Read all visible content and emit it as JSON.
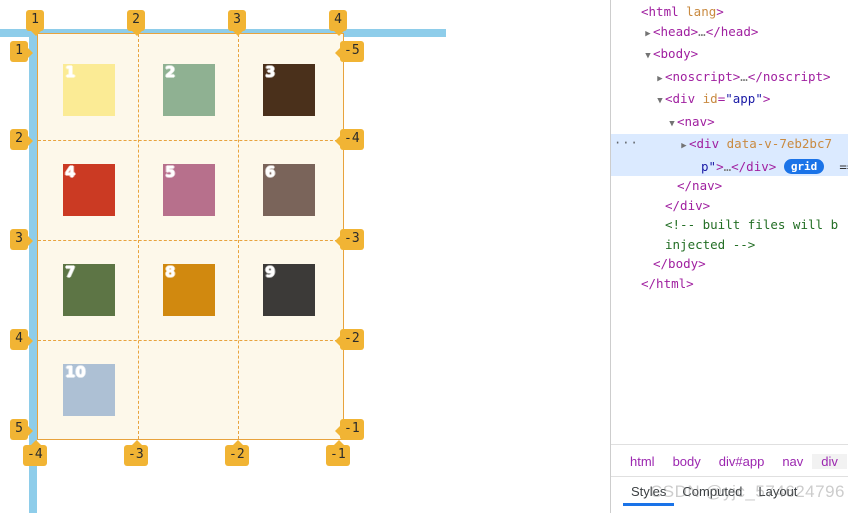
{
  "inspector": {
    "container_label": "grid-overlay",
    "grid": {
      "columns": 3,
      "rows": 4,
      "col_badges_top": [
        "1",
        "2",
        "3",
        "4"
      ],
      "col_badges_bottom": [
        "-4",
        "-3",
        "-2",
        "-1"
      ],
      "row_badges_left": [
        "1",
        "2",
        "3",
        "4",
        "5"
      ],
      "row_badges_right": [
        "-5",
        "-4",
        "-3",
        "-2",
        "-1"
      ]
    },
    "items": [
      {
        "label": "1",
        "color": "#fbeb95"
      },
      {
        "label": "2",
        "color": "#8fb192"
      },
      {
        "label": "3",
        "color": "#4a301b"
      },
      {
        "label": "4",
        "color": "#cb3a23"
      },
      {
        "label": "5",
        "color": "#b7708c"
      },
      {
        "label": "6",
        "color": "#7a645a"
      },
      {
        "label": "7",
        "color": "#5d7545"
      },
      {
        "label": "8",
        "color": "#d1890f"
      },
      {
        "label": "9",
        "color": "#3c3a38"
      },
      {
        "label": "10",
        "color": "#adc0d4"
      }
    ],
    "colors": {
      "overlay_line": "#e8a33d",
      "overlay_fill": "#fdf8ea",
      "badge_bg": "#f1b434",
      "element_highlight": "#8ecdea"
    }
  },
  "devtools": {
    "dom": [
      {
        "indent": 1,
        "twisty": "",
        "parts": [
          {
            "t": "tag",
            "s": "<html "
          },
          {
            "t": "attr",
            "s": "lang"
          },
          {
            "t": "tag",
            "s": ">"
          }
        ]
      },
      {
        "indent": 2,
        "twisty": "▶",
        "parts": [
          {
            "t": "tag",
            "s": "<head>"
          },
          {
            "t": "ellip",
            "s": "…"
          },
          {
            "t": "tag",
            "s": "</head>"
          }
        ]
      },
      {
        "indent": 2,
        "twisty": "▼",
        "parts": [
          {
            "t": "tag",
            "s": "<body>"
          }
        ]
      },
      {
        "indent": 3,
        "twisty": "▶",
        "parts": [
          {
            "t": "tag",
            "s": "<noscript>"
          },
          {
            "t": "ellip",
            "s": "…"
          },
          {
            "t": "tag",
            "s": "</noscript>"
          }
        ]
      },
      {
        "indent": 3,
        "twisty": "▼",
        "parts": [
          {
            "t": "tag",
            "s": "<div "
          },
          {
            "t": "attr",
            "s": "id"
          },
          {
            "t": "tag",
            "s": "="
          },
          {
            "t": "val",
            "s": "\"app\""
          },
          {
            "t": "tag",
            "s": ">"
          }
        ]
      },
      {
        "indent": 4,
        "twisty": "▼",
        "parts": [
          {
            "t": "tag",
            "s": "<nav>"
          }
        ]
      },
      {
        "indent": 5,
        "twisty": "▶",
        "selected": true,
        "dots": "···",
        "parts": [
          {
            "t": "tag",
            "s": "<div "
          },
          {
            "t": "attr",
            "s": "data-v-7eb2bc7"
          }
        ]
      },
      {
        "indent": 6,
        "twisty": "",
        "selected": true,
        "parts": [
          {
            "t": "val",
            "s": "p\""
          },
          {
            "t": "tag",
            "s": ">"
          },
          {
            "t": "ellip",
            "s": "…"
          },
          {
            "t": "tag",
            "s": "</div> "
          },
          {
            "t": "chip",
            "s": "grid"
          },
          {
            "t": "txt",
            "s": "  =="
          }
        ]
      },
      {
        "indent": 4,
        "twisty": "",
        "parts": [
          {
            "t": "tag",
            "s": "</nav>"
          }
        ]
      },
      {
        "indent": 3,
        "twisty": "",
        "parts": [
          {
            "t": "tag",
            "s": "</div>"
          }
        ]
      },
      {
        "indent": 3,
        "twisty": "",
        "parts": [
          {
            "t": "cmt",
            "s": "<!-- built files will b"
          }
        ]
      },
      {
        "indent": 3,
        "twisty": "",
        "parts": [
          {
            "t": "cmt",
            "s": "injected -->"
          }
        ]
      },
      {
        "indent": 2,
        "twisty": "",
        "parts": [
          {
            "t": "tag",
            "s": "</body>"
          }
        ]
      },
      {
        "indent": 1,
        "twisty": "",
        "parts": [
          {
            "t": "tag",
            "s": "</html>"
          }
        ]
      }
    ],
    "breadcrumbs": [
      {
        "label": "html",
        "active": false
      },
      {
        "label": "body",
        "active": false
      },
      {
        "label": "div#app",
        "active": false
      },
      {
        "label": "nav",
        "active": false
      },
      {
        "label": "div",
        "active": true
      }
    ],
    "tabs": [
      {
        "label": "Styles",
        "active": true
      },
      {
        "label": "Computed",
        "active": false
      },
      {
        "label": "Layout",
        "active": false
      }
    ]
  },
  "watermark": {
    "text": "CSDN @yjc_574624796"
  }
}
